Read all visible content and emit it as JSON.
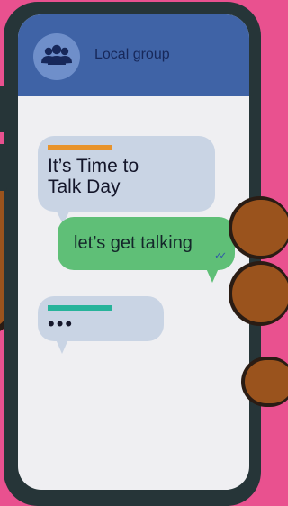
{
  "chat": {
    "group_name": "Local group",
    "messages": [
      {
        "direction": "incoming",
        "text": "It’s Time to\nTalk Day",
        "accent_color": "#e8932b"
      },
      {
        "direction": "outgoing",
        "text": "let’s get talking",
        "status": "read"
      },
      {
        "direction": "incoming",
        "text": "•••",
        "accent_color": "#27b39a"
      }
    ]
  },
  "colors": {
    "background": "#e9518f",
    "phone_frame": "#263538",
    "header": "#3f63a6",
    "incoming_bubble": "#c9d4e4",
    "outgoing_bubble": "#5fbf77",
    "skin": "#9a531d"
  },
  "icons": {
    "avatar": "group-people-icon",
    "read_receipt": "double-check-icon"
  }
}
